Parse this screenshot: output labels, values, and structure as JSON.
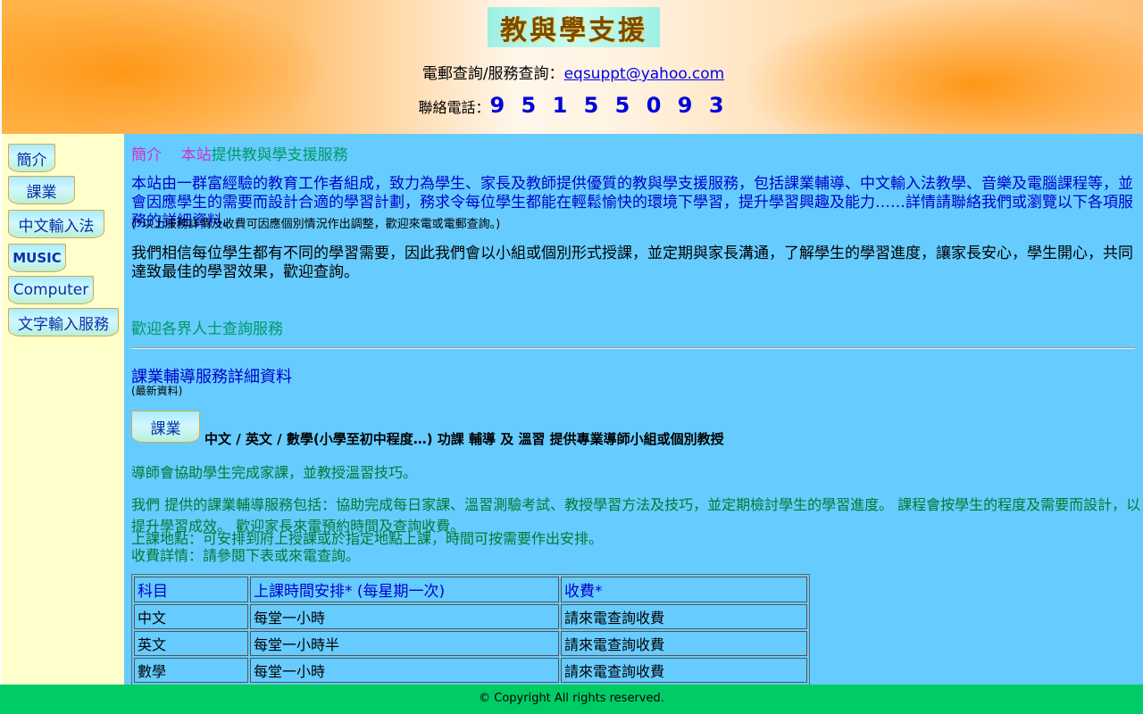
{
  "header": {
    "logo_text": "教與學支援",
    "contact_prefix": "電郵查詢/服務查詢：",
    "email": "eqsuppt@yahoo.com",
    "phone_prefix": "聯絡電話：",
    "phone": "9 5 1 5 5 0 9 3"
  },
  "sidebar": {
    "items": [
      {
        "label": "簡介"
      },
      {
        "label": "課業"
      },
      {
        "label": "中文輸入法"
      },
      {
        "label": "MUSIC"
      },
      {
        "label": "Computer"
      },
      {
        "label": "文字輸入服務"
      }
    ]
  },
  "main": {
    "title_a": "簡介",
    "title_b": "本站",
    "title_c": "提供教與學支援服務",
    "para1": "本站由一群富經驗的教育工作者組成，致力為學生、家長及教師提供優質的教與學支援服務，包括課業輔導、中文輸入法教學、音樂及電腦課程等，並會因應學生的需要而設計合適的學習計劃，務求令每位學生都能在輕鬆愉快的環境下學習，提升學習興趣及能力……詳情請聯絡我們或瀏覽以下各項服務的詳細資料。",
    "note": "(*以上服務詳情及收費可因應個別情況作出調整，歡迎來電或電郵查詢。)",
    "para2": "我們相信每位學生都有不同的學習需要，因此我們會以小組或個別形式授課，並定期與家長溝通，了解學生的學習進度，讓家長安心，學生開心，共同達致最佳的學習效果，歡迎查詢。",
    "green_heading": "歡迎各界人士查詢服務",
    "blue_heading": "課業輔導服務詳細資料",
    "subnote": "(最新資料)",
    "course_button": "課業",
    "course_line": "中文 / 英文 / 數學(小學至初中程度…) 功課 輔導 及 溫習 提供專業導師小組或個別教授",
    "green1": "導師會協助學生完成家課，並教授溫習技巧。",
    "green2": "我們 提供的課業輔導服務包括：協助完成每日家課、溫習測驗考試、教授學習方法及技巧，並定期檢討學生的學習進度。 課程會按學生的程度及需要而設計，以提升學習成效。 歡迎家長來電預約時間及查詢收費。",
    "green3": "上課地點：可安排到府上授課或於指定地點上課，時間可按需要作出安排。",
    "green4": "收費詳情：請參閱下表或來電查詢。"
  },
  "table": {
    "headers": [
      "科目",
      "上課時間安排* (每星期一次)",
      "收費*"
    ],
    "rows": [
      [
        "中文",
        "每堂一小時",
        "請來電查詢收費"
      ],
      [
        "英文",
        "每堂一小時半",
        "請來電查詢收費"
      ],
      [
        "數學",
        "每堂一小時",
        "請來電查詢收費"
      ]
    ]
  },
  "footer": {
    "text": "© Copyright All rights reserved."
  }
}
